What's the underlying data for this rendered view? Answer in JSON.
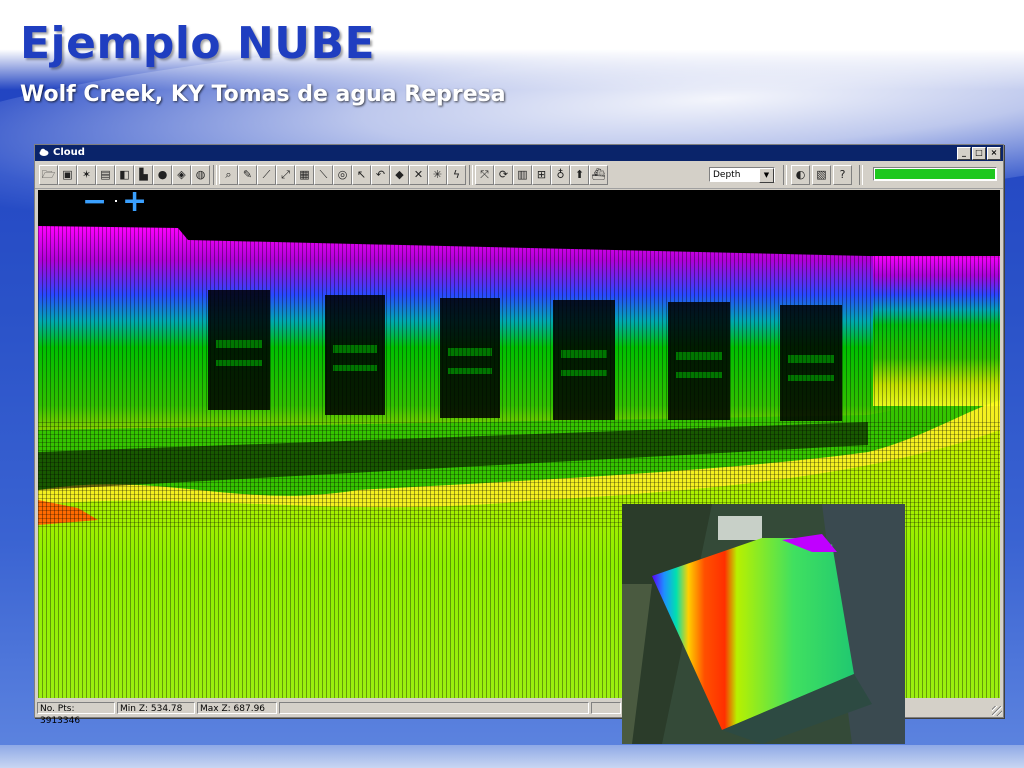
{
  "slide": {
    "title": "Ejemplo NUBE",
    "subtitle": "Wolf Creek, KY Tomas de agua Represa"
  },
  "window": {
    "title": "Cloud",
    "buttons": [
      "_",
      "□",
      "×"
    ],
    "icons": {
      "titlebar": "app-cloud-icon"
    }
  },
  "toolbar": {
    "color_mode_select": "Depth",
    "load_progress": 1.0,
    "progress_color": "#1ec81e"
  },
  "viewport": {
    "zoom_out_label": "−",
    "zoom_in_label": "+"
  },
  "status": {
    "points": "No. Pts: 3913346",
    "min_z": "Min Z: 534.78",
    "max_z": "Max Z: 687.96"
  },
  "colors": {
    "title": "#1f3ec0",
    "window_title_bar": "#0a246a",
    "depth_shallow": "#ff00ff",
    "depth_mid": "#00c000",
    "depth_deep": "#ffff00"
  }
}
